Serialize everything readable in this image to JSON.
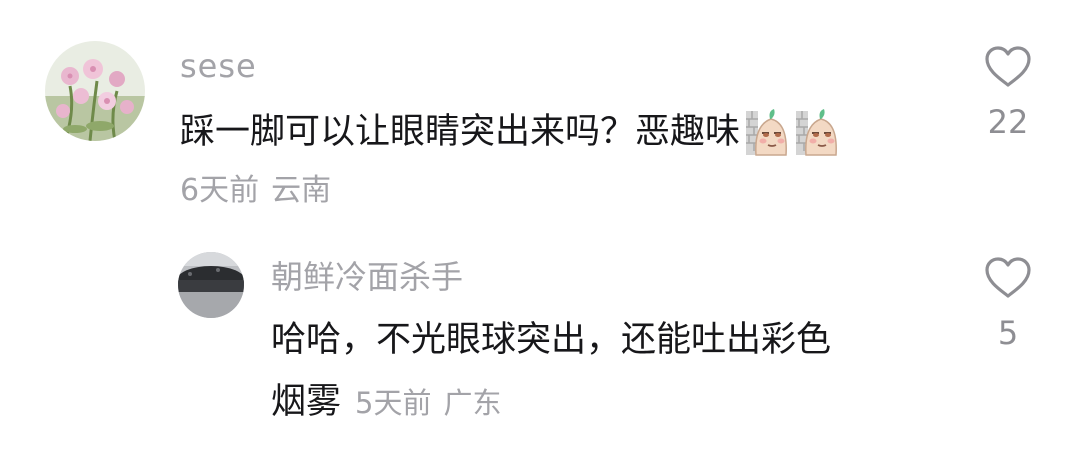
{
  "comment": {
    "username": "sese",
    "text": "踩一脚可以让眼睛突出来吗？恶趣味",
    "emojis": [
      "embarrassed-potato-emoji",
      "embarrassed-potato-emoji"
    ],
    "time": "6天前",
    "location": "云南",
    "like_count": "22"
  },
  "reply": {
    "username": "朝鲜冷面杀手",
    "text_line1": "哈哈，不光眼球突出，还能吐出彩色",
    "text_line2": "烟雾",
    "time": "5天前",
    "location": "广东",
    "like_count": "5"
  },
  "icons": {
    "like": "heart-outline-icon"
  }
}
